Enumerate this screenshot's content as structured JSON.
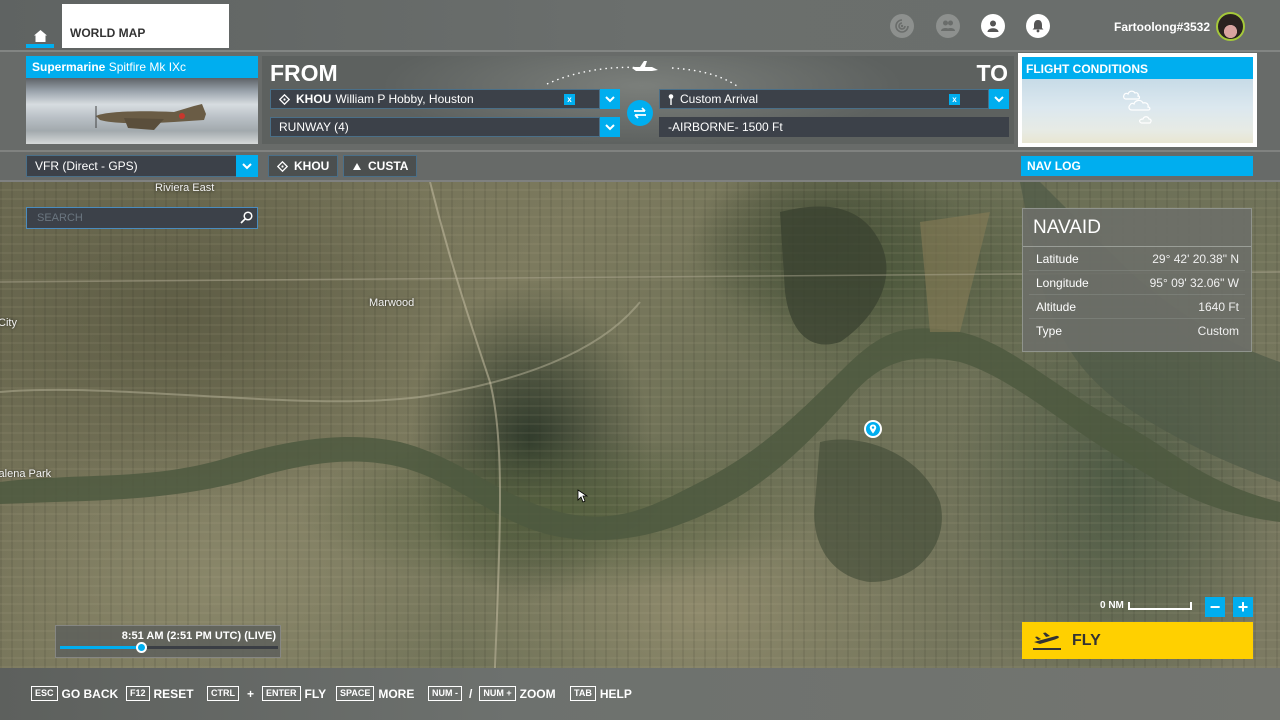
{
  "colors": {
    "accent": "#00aeef",
    "fly": "#ffd000",
    "avatar_ring": "#a5c93a"
  },
  "topbar": {
    "home_icon": "home-icon",
    "tab_label": "WORLD MAP",
    "icons": [
      "activity-icon",
      "friends-icon",
      "profile-icon",
      "bell-icon"
    ],
    "username": "Fartoolong#3532"
  },
  "aircraft": {
    "manufacturer": "Supermarine",
    "model": "Spitfire Mk IXc"
  },
  "route": {
    "from_label": "FROM",
    "to_label": "TO",
    "departure": {
      "code": "KHOU",
      "name": "William P Hobby, Houston",
      "clear_label": "x"
    },
    "departure_runway": "RUNWAY (4)",
    "arrival": {
      "name": "Custom Arrival",
      "clear_label": "x"
    },
    "arrival_detail": "-AIRBORNE- 1500 Ft"
  },
  "flight_conditions": {
    "title": "FLIGHT CONDITIONS"
  },
  "flight_plan": {
    "type": "VFR (Direct - GPS)",
    "waypoints": [
      {
        "icon": "airport-icon",
        "label": "KHOU"
      },
      {
        "icon": "triangle-icon",
        "label": "CUSTA"
      }
    ],
    "nav_log_label": "NAV LOG"
  },
  "search": {
    "placeholder": "SEARCH"
  },
  "map": {
    "labels": [
      "Riviera East",
      "Marwood",
      "City",
      "Galena Park"
    ]
  },
  "navaid": {
    "title": "NAVAID",
    "rows": [
      {
        "label": "Latitude",
        "value": "29° 42' 20.38\" N"
      },
      {
        "label": "Longitude",
        "value": "95° 09' 32.06\" W"
      },
      {
        "label": "Altitude",
        "value": "1640 Ft"
      },
      {
        "label": "Type",
        "value": "Custom"
      }
    ]
  },
  "time": {
    "label": "8:51 AM (2:51 PM UTC) (LIVE)",
    "progress": 0.37
  },
  "scale": {
    "label": "0 NM"
  },
  "zoom": {
    "out_label": "−",
    "in_label": "+"
  },
  "fly": {
    "label": "FLY"
  },
  "hints": [
    {
      "keys": [
        "ESC"
      ],
      "action": "GO BACK"
    },
    {
      "keys": [
        "F12"
      ],
      "action": "RESET"
    },
    {
      "keys": [
        "CTRL",
        "ENTER"
      ],
      "joiner": "+",
      "action": "FLY"
    },
    {
      "keys": [
        "SPACE"
      ],
      "action": "MORE"
    },
    {
      "keys": [
        "NUM -",
        "NUM +"
      ],
      "joiner": "/",
      "action": "ZOOM"
    },
    {
      "keys": [
        "TAB"
      ],
      "action": "HELP"
    }
  ]
}
